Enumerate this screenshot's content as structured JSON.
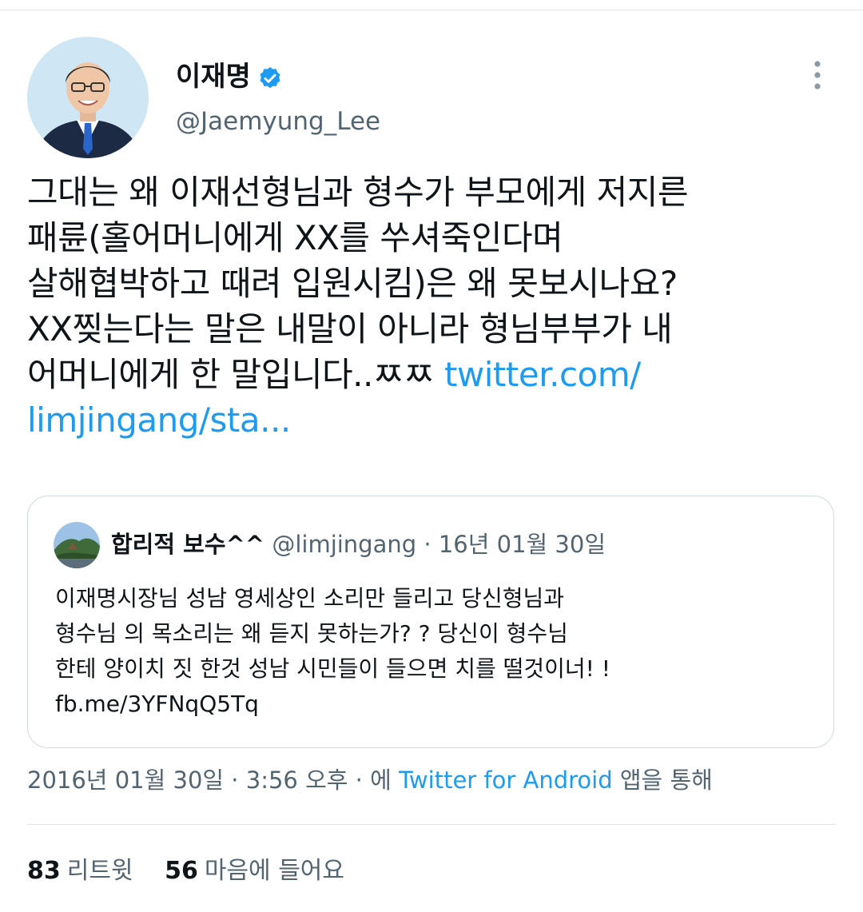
{
  "author": {
    "display_name": "이재명",
    "handle": "@Jaemyung_Lee",
    "verified": true
  },
  "tweet": {
    "lines": [
      "그대는 왜 이재선형님과 형수가 부모에게 저지른",
      "패륜(홀어머니에게 XX를 쑤셔죽인다며",
      "살해협박하고 때려 입원시킴)은 왜 못보시나요?",
      "XX찢는다는 말은 내말이 아니라 형님부부가 내"
    ],
    "line5_text": "어머니에게 한 말입니다..ㅉㅉ ",
    "link_part1": "twitter.com/",
    "link_part2": "limjingang/sta..."
  },
  "quote": {
    "name": "합리적 보수^^",
    "handle": "@limjingang",
    "date": "16년 01월 30일",
    "separator": " · ",
    "lines": [
      "이재명시장님 성남 영세상인 소리만 들리고 당신형님과",
      "형수님 의 목소리는 왜 듣지 못하는가? ? 당신이  형수님",
      "한테  양이치 짓 한것 성남 시민들이 들으면 치를 떨것이너! !",
      "fb.me/3YFNqQ5Tq"
    ]
  },
  "timestamp": {
    "date": "2016년 01월 30일",
    "time": "3:56 오후",
    "prefix": "에 ",
    "source": "Twitter for Android",
    "suffix": " 앱을 통해",
    "separator": " · "
  },
  "stats": {
    "retweets_count": "83",
    "retweets_label": "리트윗",
    "likes_count": "56",
    "likes_label": "마음에 들어요"
  },
  "colors": {
    "link": "#1d9bf0",
    "secondary_text": "#536471",
    "primary_text": "#0f1419",
    "border": "#cfd9de"
  },
  "icons": {
    "verified": "verified-badge-icon",
    "more": "more-vertical-icon"
  }
}
